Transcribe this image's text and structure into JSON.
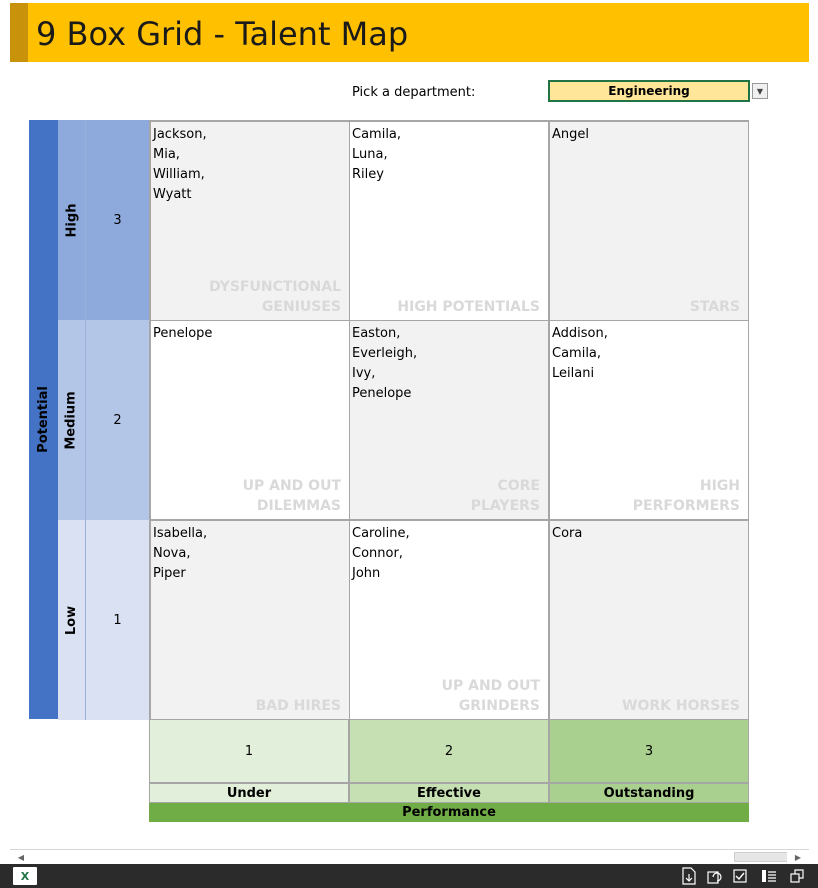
{
  "title": "9 Box Grid - Talent Map",
  "department_picker": {
    "label": "Pick a department:",
    "selected": "Engineering"
  },
  "potential": {
    "axis_label": "Potential",
    "levels": [
      {
        "label": "High",
        "number": "3"
      },
      {
        "label": "Medium",
        "number": "2"
      },
      {
        "label": "Low",
        "number": "1"
      }
    ]
  },
  "grid": {
    "rows": [
      [
        {
          "names": [
            "Jackson,",
            "Mia,",
            "William,",
            "Wyatt"
          ],
          "label": [
            "DYSFUNCTIONAL",
            "GENIUSES"
          ]
        },
        {
          "names": [
            "Camila,",
            "Luna,",
            "Riley"
          ],
          "label": [
            "HIGH POTENTIALS"
          ]
        },
        {
          "names": [
            "Angel"
          ],
          "label": [
            "STARS"
          ]
        }
      ],
      [
        {
          "names": [
            "Penelope"
          ],
          "label": [
            "UP AND OUT",
            "DILEMMAS"
          ]
        },
        {
          "names": [
            "Easton,",
            "Everleigh,",
            "Ivy,",
            "Penelope"
          ],
          "label": [
            "CORE",
            "PLAYERS"
          ]
        },
        {
          "names": [
            "Addison,",
            "Camila,",
            "Leilani"
          ],
          "label": [
            "HIGH",
            "PERFORMERS"
          ]
        }
      ],
      [
        {
          "names": [
            "Isabella,",
            "Nova,",
            "Piper"
          ],
          "label": [
            "BAD HIRES"
          ]
        },
        {
          "names": [
            "Caroline,",
            "Connor,",
            "John"
          ],
          "label": [
            "UP AND OUT",
            "GRINDERS"
          ]
        },
        {
          "names": [
            "Cora"
          ],
          "label": [
            "WORK HORSES"
          ]
        }
      ]
    ]
  },
  "performance": {
    "axis_label": "Performance",
    "levels": [
      {
        "number": "1",
        "label": "Under"
      },
      {
        "number": "2",
        "label": "Effective"
      },
      {
        "number": "3",
        "label": "Outstanding"
      }
    ]
  },
  "status_bar": {
    "app_icon_text": "X",
    "icons": [
      "download-icon",
      "refresh-icon",
      "calculate-icon",
      "reading-view-icon",
      "popout-icon"
    ]
  },
  "colors": {
    "title_bg": "#ffc000",
    "potential_axis": "#4472c4",
    "performance_axis": "#70ad47",
    "box_label": "#d9d9d9"
  }
}
